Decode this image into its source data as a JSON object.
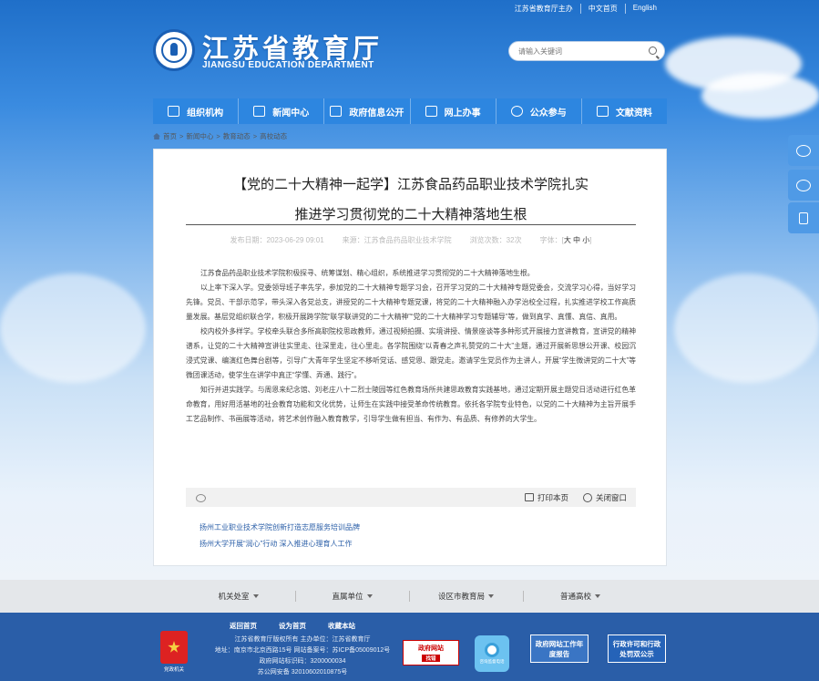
{
  "header": {
    "top_links": [
      "江苏省教育厅主办",
      "中文首页",
      "English"
    ],
    "site_title": "江苏省教育厅",
    "site_subtitle": "JIANGSU EDUCATION DEPARTMENT",
    "search_placeholder": "请输入关键词"
  },
  "nav": {
    "items": [
      {
        "label": "组织机构",
        "icon": "org-icon"
      },
      {
        "label": "新闻中心",
        "icon": "news-icon"
      },
      {
        "label": "政府信息公开",
        "icon": "megaphone-icon"
      },
      {
        "label": "网上办事",
        "icon": "monitor-icon"
      },
      {
        "label": "公众参与",
        "icon": "heart-icon"
      },
      {
        "label": "文献资料",
        "icon": "book-icon"
      }
    ]
  },
  "breadcrumb": [
    "首页",
    "新闻中心",
    "教育动态",
    "高校动态"
  ],
  "article": {
    "title_line1": "【党的二十大精神一起学】江苏食品药品职业技术学院扎实",
    "title_line2": "推进学习贯彻党的二十大精神落地生根",
    "meta_date": "发布日期：2023-06-29 09:01",
    "meta_source": "来源：江苏食品药品职业技术学院",
    "meta_views": "浏览次数：32次",
    "meta_font_label": "字体：[",
    "meta_font_sizes": "大 中 小",
    "meta_font_end": "]",
    "paragraphs": [
      "江苏食品药品职业技术学院积极探寻、统筹谋划、精心组织，系统推进学习贯彻党的二十大精神落地生根。",
      "以上率下深入学。党委领导班子率先学，参加党的二十大精神专题学习会，召开学习党的二十大精神专题党委会，交流学习心得，当好学习先锋。党员、干部示范学，带头深入各党总支，讲授党的二十大精神专题党课，将党的二十大精神融入办学治校全过程，扎实推进学校工作高质量发展。基层党组织联合学，积极开展跨学院“联学联讲党的二十大精神”“党的二十大精神学习专题辅导”等，做到真学、真懂、真信、真用。",
      "校内校外多样学。学校牵头联合多所高职院校思政教师，通过视频拍摄、实境讲授、情景座谈等多种形式开展接力宣讲教育，宣讲党的精神谱系，让党的二十大精神宣讲往实里走、往深里走，往心里走。各学院围绕“以青春之声礼赞党的二十大”主题，通过开展新思想公开课、校园沉浸式党课、编演红色舞台剧等，引导广大青年学生坚定不移听党话、感党恩、跟党走。邀请学生党员作为主讲人，开展“学生微讲党的二十大”等微团课活动，使学生在讲学中真正“学懂、弄通、践行”。",
      "知行并进实践学。与周恩来纪念馆、刘老庄八十二烈士陵园等红色教育场所共建思政教育实践基地，通过定期开展主题党日活动进行红色革命教育，用好用活基地的社会教育功能和文化优势，让师生在实践中接受革命传统教育。依托各学院专业特色，以党的二十大精神为主旨开展手工艺品制作、书画展等活动，将艺术创作融入教育教学，引导学生做有担当、有作为、有品质、有修养的大学生。"
    ],
    "print_label": "打印本页",
    "close_label": "关闭窗口",
    "related": [
      "扬州工业职业技术学院创新打造志愿服务培训品牌",
      "扬州大学开展“润心”行动 深入推进心理育人工作"
    ]
  },
  "side_tools": [
    "weibo-icon",
    "wechat-icon",
    "top-icon"
  ],
  "footer_links": [
    "机关处室",
    "直属单位",
    "设区市教育局",
    "普通高校"
  ],
  "footer": {
    "links": [
      "返回首页",
      "设为首页",
      "收藏本站"
    ],
    "info": [
      "江苏省教育厅版权所有 主办单位：江苏省教育厅",
      "地址：南京市北京西路15号 网站备案号：苏ICP备05009012号",
      "政府网站标识码：3200000034",
      "苏公网安备 32010602010875号"
    ],
    "party_label": "党政机关",
    "gov_badge_title": "政府网站",
    "gov_badge_sub": "找错",
    "tel_badge_label": "咨询监督电话",
    "box_a": "政府网站工作年度报告",
    "box_b": "行政许可和行政处罚双公示"
  },
  "colors": {
    "nav_bg": "#2d86e0",
    "footer_bg": "#2a5ea8",
    "link": "#2b5fa8"
  }
}
